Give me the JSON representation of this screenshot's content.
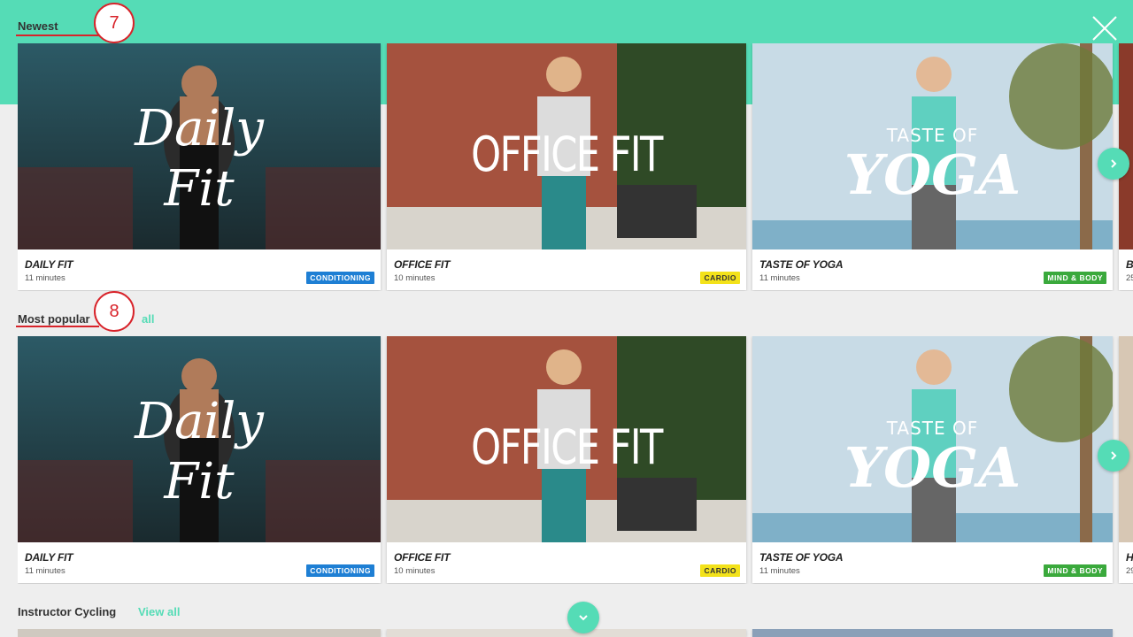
{
  "sections": [
    {
      "title": "Newest",
      "view_all": "",
      "marker": "7"
    },
    {
      "title": "Most popular",
      "view_all": "all",
      "marker": "8"
    },
    {
      "title": "Instructor Cycling",
      "view_all": "View all"
    }
  ],
  "cards": [
    {
      "title": "DAILY FIT",
      "duration": "11 minutes",
      "tag": "CONDITIONING",
      "tag_bg": "#1e7fd4",
      "tag_fg": "#ffffff",
      "art_text_1": "Daily",
      "art_text_2": "Fit"
    },
    {
      "title": "OFFICE FIT",
      "duration": "10 minutes",
      "tag": "CARDIO",
      "tag_bg": "#f3e21a",
      "tag_fg": "#333333",
      "art_text_1": "OFFICE FIT"
    },
    {
      "title": "TASTE OF YOGA",
      "duration": "11 minutes",
      "tag": "MIND & BODY",
      "tag_bg": "#3aa93c",
      "tag_fg": "#ffffff",
      "art_text_1": "TASTE OF",
      "art_text_2": "YOGA"
    }
  ],
  "partial_cards": [
    {
      "title": "B",
      "duration": "25"
    },
    {
      "title": "H",
      "duration": "29"
    }
  ],
  "colors": {
    "accent": "#55dcb6",
    "marker": "#d8232a"
  },
  "icons": {
    "close": "close-icon",
    "next": "chevron-right-icon",
    "down": "chevron-down-icon"
  }
}
